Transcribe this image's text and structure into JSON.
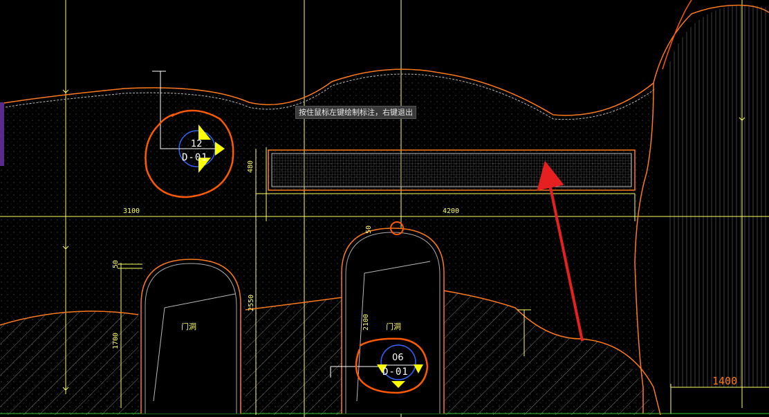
{
  "command_prompt": "按住鼠标左键绘制标注，右键退出",
  "callouts": [
    {
      "number": "12",
      "sheet": "D-01"
    },
    {
      "number": "06",
      "sheet": "D-01"
    }
  ],
  "dimensions": {
    "d480": "480",
    "d3100": "3100",
    "d4200": "4200",
    "d50a": "50",
    "d50b": "50",
    "d1700": "1700",
    "d2550": "2550",
    "d2100": "2100",
    "d1400": "1400"
  },
  "door_labels": [
    "门洞",
    "门洞"
  ],
  "colors": {
    "background": "#000000",
    "guide_lines": "#ffff66",
    "outline": "#ff7a1a",
    "markup": "#ff5a00",
    "arrow": "#e62020",
    "callout_circle": "#3366ff",
    "callout_flag": "#ffff00"
  }
}
